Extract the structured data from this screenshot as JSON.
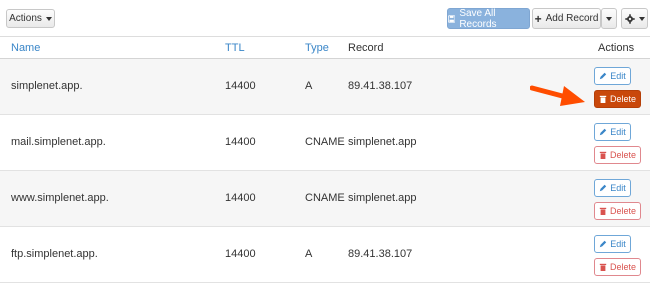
{
  "toolbar": {
    "actions_label": "Actions",
    "save_label": "Save All Records",
    "add_label": "Add Record"
  },
  "table": {
    "headers": {
      "name": "Name",
      "ttl": "TTL",
      "type": "Type",
      "record": "Record",
      "actions": "Actions"
    },
    "rows": [
      {
        "name": "simplenet.app.",
        "ttl": "14400",
        "type": "A",
        "record": "89.41.38.107"
      },
      {
        "name": "mail.simplenet.app.",
        "ttl": "14400",
        "type": "CNAME",
        "record": "simplenet.app"
      },
      {
        "name": "www.simplenet.app.",
        "ttl": "14400",
        "type": "CNAME",
        "record": "simplenet.app"
      },
      {
        "name": "ftp.simplenet.app.",
        "ttl": "14400",
        "type": "A",
        "record": "89.41.38.107"
      }
    ],
    "edit_label": "Edit",
    "delete_label": "Delete"
  },
  "colors": {
    "link": "#3a86c8",
    "save_button": "#8ab2dd",
    "delete_active": "#c9480b",
    "delete_outline": "#d9534f",
    "arrow": "#ff4d00"
  },
  "icons": {
    "save": "floppy-icon",
    "add": "plus-icon",
    "settings": "gear-icon",
    "edit": "pencil-icon",
    "delete": "trash-icon",
    "callout": "arrow-icon"
  }
}
